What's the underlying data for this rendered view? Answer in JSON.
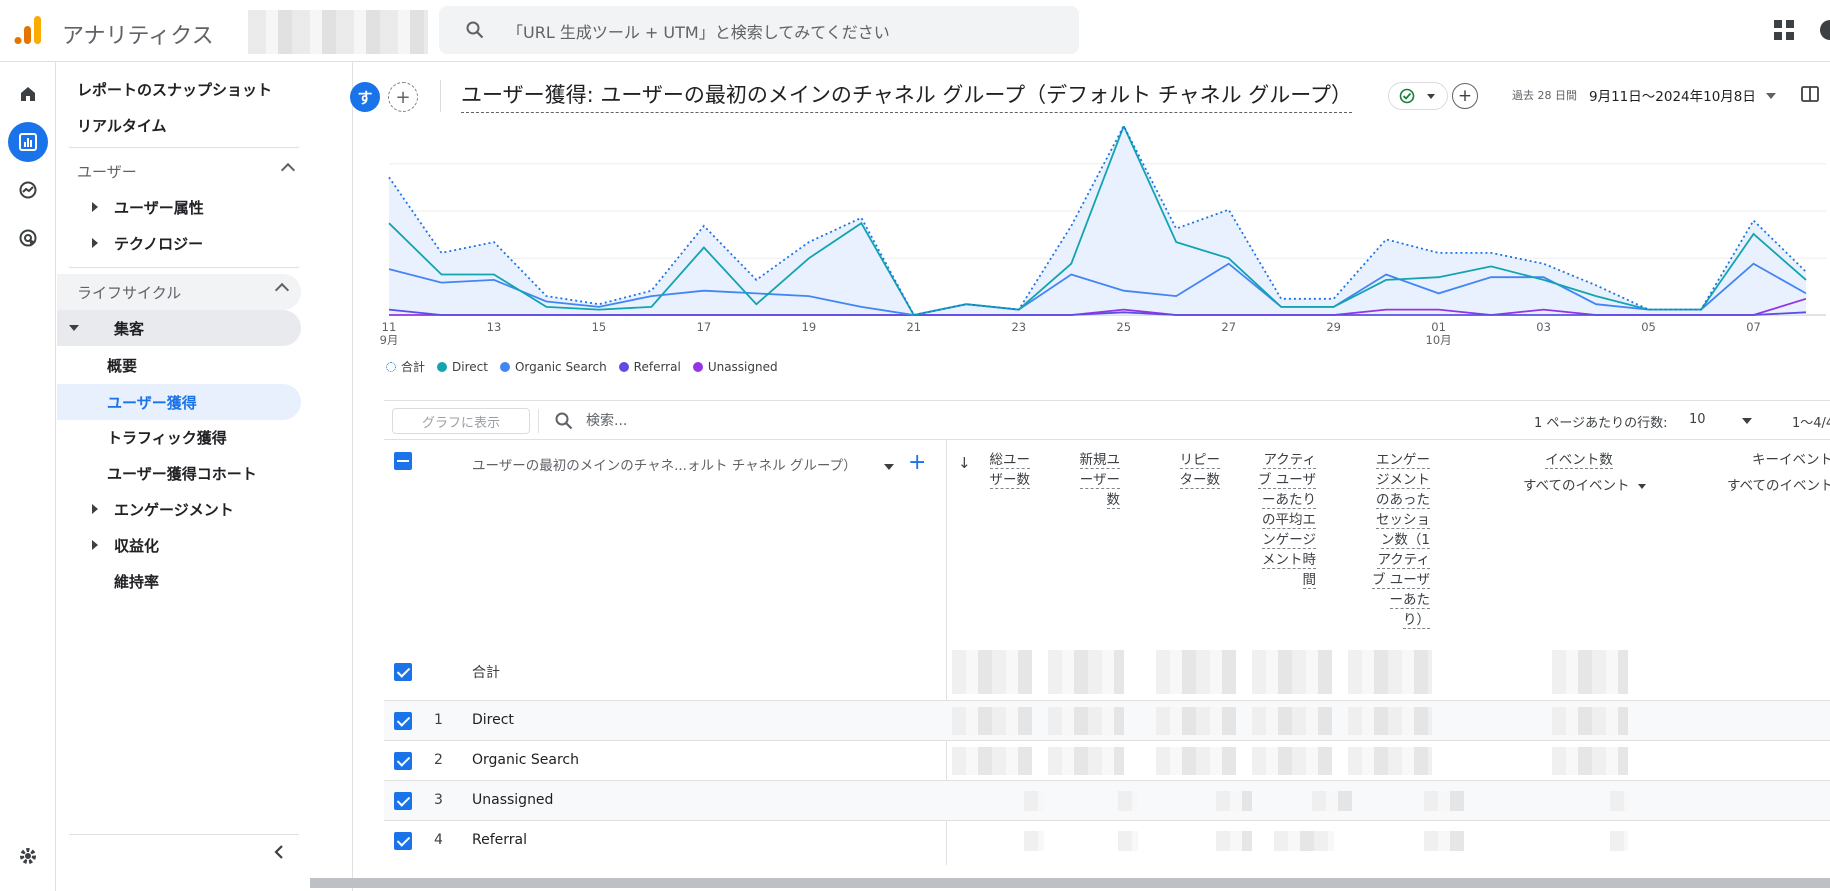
{
  "app": {
    "title": "アナリティクス"
  },
  "search": {
    "placeholder": "「URL 生成ツール + UTM」と検索してみてください"
  },
  "nav": {
    "snapshot": "レポートのスナップショット",
    "realtime": "リアルタイム",
    "user_header": "ユーザー",
    "user_attributes": "ユーザー属性",
    "technology": "テクノロジー",
    "lifecycle_header": "ライフサイクル",
    "acquisition": "集客",
    "overview": "概要",
    "user_acquisition": "ユーザー獲得",
    "traffic_acquisition": "トラフィック獲得",
    "user_acq_cohort": "ユーザー獲得コホート",
    "engagement": "エンゲージメント",
    "monetization": "収益化",
    "retention": "維持率"
  },
  "header": {
    "avatar_letter": "す",
    "title": "ユーザー獲得: ユーザーの最初のメインのチャネル グループ（デフォルト チャネル グループ）",
    "date_label": "過去 28 日間",
    "date_range": "9月11日～2024年10月8日"
  },
  "chart_data": {
    "type": "line",
    "x": [
      "9月11日",
      "9月12日",
      "9月13日",
      "9月14日",
      "9月15日",
      "9月16日",
      "9月17日",
      "9月18日",
      "9月19日",
      "9月20日",
      "9月21日",
      "9月22日",
      "9月23日",
      "9月24日",
      "9月25日",
      "9月26日",
      "9月27日",
      "9月28日",
      "9月29日",
      "9月30日",
      "10月1日",
      "10月2日",
      "10月3日",
      "10月4日",
      "10月5日",
      "10月6日",
      "10月7日",
      "10月8日"
    ],
    "x_tick_labels": [
      "11\n9月",
      "13",
      "15",
      "17",
      "19",
      "21",
      "23",
      "25",
      "27",
      "29",
      "01\n10月",
      "03",
      "05",
      "07"
    ],
    "ylim": [
      0,
      70
    ],
    "series": [
      {
        "name": "合計",
        "style": "dotted",
        "color": "#1a73e8",
        "values": [
          51,
          23,
          27,
          7,
          4,
          9,
          33,
          13,
          27,
          36,
          0,
          4,
          2,
          33,
          75,
          32,
          39,
          6,
          6,
          28,
          23,
          23,
          19,
          11,
          2,
          2,
          35,
          16
        ]
      },
      {
        "name": "Direct",
        "color": "#12a4af",
        "values": [
          34,
          15,
          15,
          3,
          2,
          3,
          25,
          4,
          21,
          34,
          0,
          4,
          2,
          19,
          71,
          27,
          21,
          3,
          3,
          13,
          14,
          18,
          13,
          7,
          2,
          2,
          30,
          13
        ]
      },
      {
        "name": "Organic Search",
        "color": "#4285f4",
        "values": [
          17,
          12,
          13,
          5,
          3,
          7,
          9,
          8,
          7,
          3,
          0,
          4,
          2,
          15,
          9,
          7,
          19,
          3,
          3,
          15,
          8,
          14,
          14,
          4,
          2,
          2,
          19,
          8
        ]
      },
      {
        "name": "Referral",
        "color": "#5c4ee5",
        "values": [
          2,
          0,
          0,
          0,
          0,
          0,
          0,
          0,
          0,
          0,
          0,
          0,
          0,
          0,
          1,
          0,
          0,
          0,
          0,
          0,
          0,
          0,
          0,
          0,
          0,
          0,
          0,
          1
        ]
      },
      {
        "name": "Unassigned",
        "color": "#9334e6",
        "values": [
          0,
          0,
          0,
          0,
          0,
          0,
          0,
          0,
          0,
          0,
          0,
          0,
          0,
          0,
          2,
          0,
          0,
          0,
          0,
          2,
          2,
          0,
          2,
          0,
          0,
          0,
          0,
          6
        ]
      }
    ]
  },
  "toolbar": {
    "plot_btn": "グラフに表示",
    "search_placeholder": "検索...",
    "rows_label": "1 ページあたりの行数:",
    "rows_value": "10",
    "page_info": "1～4/4"
  },
  "table": {
    "dimension_header": "ユーザーの最初のメインのチャネ...ォルト チャネル グループ）",
    "metrics": [
      {
        "lines": [
          "総ユー",
          "ザー数"
        ]
      },
      {
        "lines": [
          "新規ユ",
          "ーザー",
          "数"
        ]
      },
      {
        "lines": [
          "リピー",
          "ター数"
        ]
      },
      {
        "lines": [
          "アクティ",
          "ブ ユーザ",
          "ーあたり",
          "の平均エ",
          "ンゲージ",
          "メント時",
          "間"
        ]
      },
      {
        "lines": [
          "エンゲー",
          "ジメント",
          "のあった",
          "セッショ",
          "ン数（1",
          "アクティ",
          "ブ ユーザ",
          "ーあた",
          "り）"
        ]
      }
    ],
    "event_header": "イベント数",
    "event_sub": "すべてのイベント",
    "key_event_header": "キーイベント",
    "key_event_sub": "すべてのイベント",
    "total_label": "合計",
    "rows": [
      {
        "num": "1",
        "name": "Direct"
      },
      {
        "num": "2",
        "name": "Organic Search"
      },
      {
        "num": "3",
        "name": "Unassigned"
      },
      {
        "num": "4",
        "name": "Referral"
      }
    ]
  }
}
